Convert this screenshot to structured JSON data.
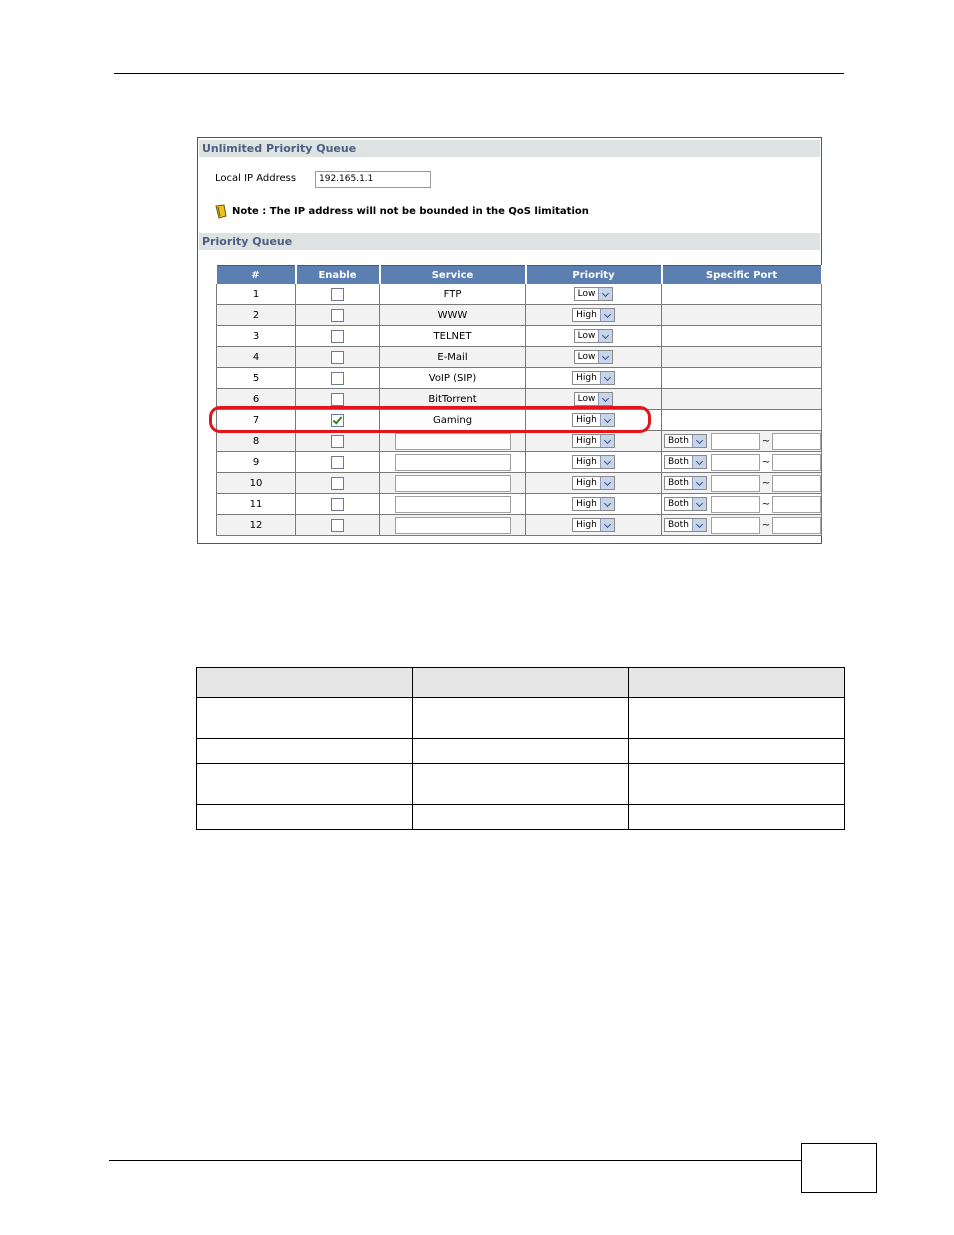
{
  "screenshot": {
    "section_unlimited": "Unlimited Priority Queue",
    "local_ip_label": "Local IP Address",
    "local_ip_value": "192.165.1.1",
    "note_text": "Note : The IP address will not be bounded in the QoS limitation",
    "section_priority": "Priority Queue",
    "columns": [
      "#",
      "Enable",
      "Service",
      "Priority",
      "Specific Port"
    ],
    "rows": [
      {
        "num": "1",
        "enabled": false,
        "service": "FTP",
        "priority": "Low"
      },
      {
        "num": "2",
        "enabled": false,
        "service": "WWW",
        "priority": "High"
      },
      {
        "num": "3",
        "enabled": false,
        "service": "TELNET",
        "priority": "Low"
      },
      {
        "num": "4",
        "enabled": false,
        "service": "E-Mail",
        "priority": "Low"
      },
      {
        "num": "5",
        "enabled": false,
        "service": "VoIP (SIP)",
        "priority": "High"
      },
      {
        "num": "6",
        "enabled": false,
        "service": "BitTorrent",
        "priority": "Low"
      },
      {
        "num": "7",
        "enabled": true,
        "service": "Gaming",
        "priority": "High"
      },
      {
        "num": "8",
        "enabled": false,
        "service": "",
        "priority": "High",
        "protocol": "Both"
      },
      {
        "num": "9",
        "enabled": false,
        "service": "",
        "priority": "High",
        "protocol": "Both"
      },
      {
        "num": "10",
        "enabled": false,
        "service": "",
        "priority": "High",
        "protocol": "Both"
      },
      {
        "num": "11",
        "enabled": false,
        "service": "",
        "priority": "High",
        "protocol": "Both"
      },
      {
        "num": "12",
        "enabled": false,
        "service": "",
        "priority": "High",
        "protocol": "Both"
      }
    ],
    "port_separator": "~",
    "highlight_color": "#e3141b",
    "header_color": "#5a7fb0"
  }
}
